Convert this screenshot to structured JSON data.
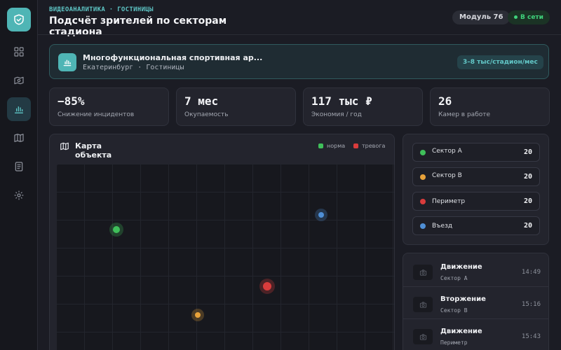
{
  "header": {
    "eyebrow": "ВИДЕОАНАЛИТИКА · ГОСТИНИЦЫ",
    "title": "Подсчёт зрителей по секторам стадиона",
    "module": "Модуль 76",
    "status": "В сети"
  },
  "sidebar": {
    "logo_icon": "shield-check-icon",
    "items": [
      {
        "icon": "grid-icon",
        "active": false
      },
      {
        "icon": "camera-map-icon",
        "active": false
      },
      {
        "icon": "bar-chart-icon",
        "active": true
      },
      {
        "icon": "map-icon",
        "active": false
      },
      {
        "icon": "document-icon",
        "active": false
      },
      {
        "icon": "gear-icon",
        "active": false
      }
    ]
  },
  "object": {
    "name": "Многофункциональная спортивная ар...",
    "city": "Екатеринбург",
    "category": "Гостиницы",
    "throughput": "3–8 тыс/стадион/мес"
  },
  "kpis": [
    {
      "value": "−85%",
      "label": "Снижение инцидентов"
    },
    {
      "value": "7 мес",
      "label": "Окупаемость"
    },
    {
      "value": "117 тыс ₽",
      "label": "Экономия / год"
    },
    {
      "value": "26",
      "label": "Камер в работе"
    }
  ],
  "map": {
    "title": "Карта объекта",
    "legend": [
      {
        "label": "норма",
        "color": "#3fbf5a"
      },
      {
        "label": "тревога",
        "color": "#d93c3c"
      }
    ]
  },
  "sectors": [
    {
      "name": "Сектор А",
      "count": "20",
      "color": "#3fbf5a"
    },
    {
      "name": "Сектор В",
      "count": "20",
      "color": "#e8a23a"
    },
    {
      "name": "Периметр",
      "count": "20",
      "color": "#d93c3c"
    },
    {
      "name": "Въезд",
      "count": "20",
      "color": "#4f8fd6"
    }
  ],
  "events": [
    {
      "type": "Движение",
      "sector": "Сектор А",
      "time": "14:49"
    },
    {
      "type": "Вторжение",
      "sector": "Сектор В",
      "time": "15:16"
    },
    {
      "type": "Движение",
      "sector": "Периметр",
      "time": "15:43"
    }
  ],
  "colors": {
    "accent": "#4fb5b5",
    "online": "#3fd27b"
  }
}
